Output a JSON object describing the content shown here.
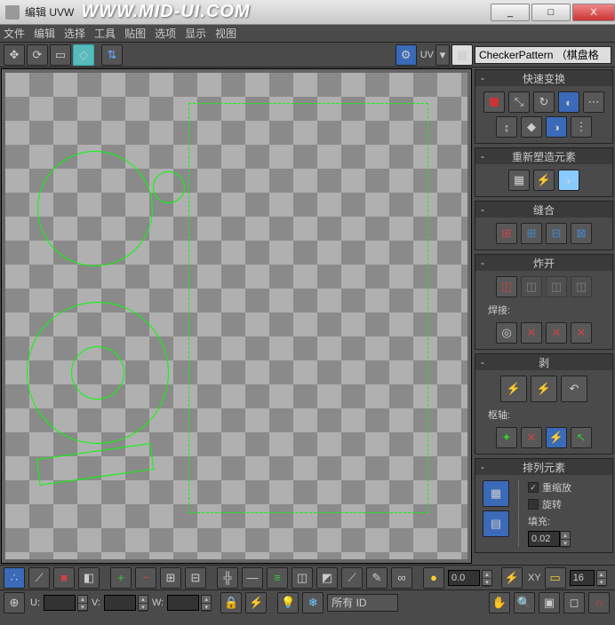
{
  "window": {
    "title": "编辑 UVW",
    "watermark": "WWW.MID-UI.COM"
  },
  "sysbtns": {
    "min": "_",
    "max": "□",
    "close": "X"
  },
  "menu": [
    "文件",
    "编辑",
    "选择",
    "工具",
    "贴图",
    "选项",
    "显示",
    "视图"
  ],
  "uv_label": "UV",
  "checker_dropdown": "CheckerPattern  （棋盘格",
  "panels": {
    "quick": "快速变换",
    "reshape": "重新塑造元素",
    "stitch": "缝合",
    "explode": "炸开",
    "weld": "焊接:",
    "peel": "剥",
    "pivot": "枢轴:",
    "arrange": "排列元素"
  },
  "arrange": {
    "rescale": "重缩放",
    "rotate": "旋转",
    "padding": "填充:",
    "pad_val": "0.02"
  },
  "bottom": {
    "zero": "0.0",
    "xy": "XY",
    "sixteen": "16",
    "u": "U:",
    "v": "V:",
    "w": "W:",
    "all_id": "所有 ID"
  }
}
